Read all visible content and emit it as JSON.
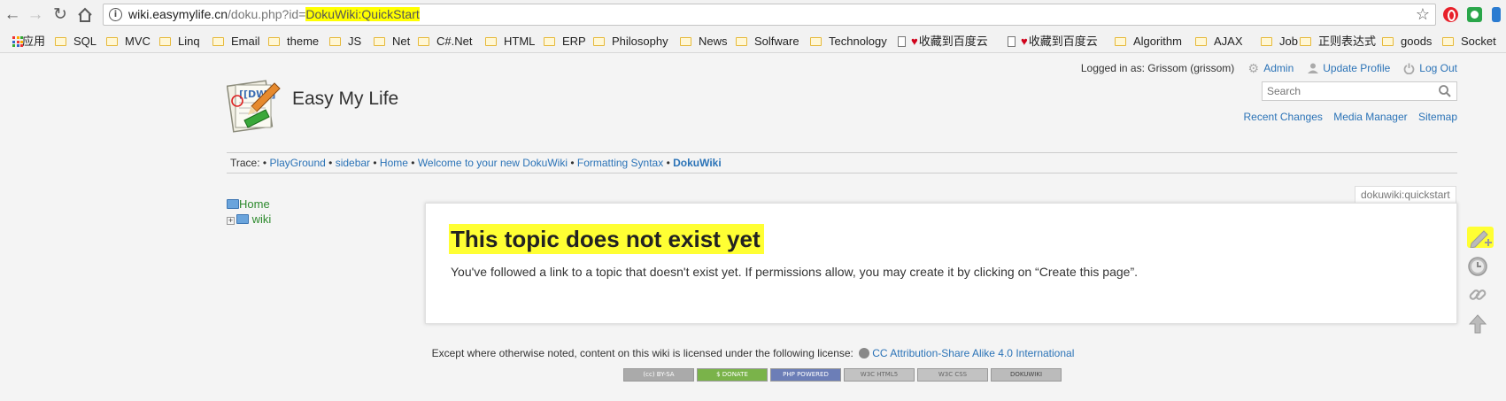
{
  "browser": {
    "url_host": "wiki.easymylife.cn",
    "url_path": "/doku.php?id=",
    "url_query_highlight": "DokuWiki:QuickStart",
    "bookmarks": [
      {
        "label": "应用",
        "type": "apps"
      },
      {
        "label": "SQL",
        "type": "folder"
      },
      {
        "label": "MVC",
        "type": "folder"
      },
      {
        "label": "Linq",
        "type": "folder"
      },
      {
        "label": "Email",
        "type": "folder"
      },
      {
        "label": "theme",
        "type": "folder"
      },
      {
        "label": "JS",
        "type": "folder"
      },
      {
        "label": "Net",
        "type": "folder"
      },
      {
        "label": "C#.Net",
        "type": "folder"
      },
      {
        "label": "HTML",
        "type": "folder"
      },
      {
        "label": "ERP",
        "type": "folder"
      },
      {
        "label": "Philosophy",
        "type": "folder"
      },
      {
        "label": "News",
        "type": "folder"
      },
      {
        "label": "Solfware",
        "type": "folder"
      },
      {
        "label": "Technology",
        "type": "folder"
      },
      {
        "label": "收藏到百度云",
        "type": "page-heart"
      },
      {
        "label": "收藏到百度云",
        "type": "page-heart"
      },
      {
        "label": "Algorithm",
        "type": "folder"
      },
      {
        "label": "AJAX",
        "type": "folder"
      },
      {
        "label": "Job",
        "type": "folder"
      },
      {
        "label": "正则表达式",
        "type": "folder"
      },
      {
        "label": "goods",
        "type": "folder"
      },
      {
        "label": "Socket",
        "type": "folder"
      }
    ]
  },
  "header": {
    "site_title": "Easy My Life",
    "logged_in_text": "Logged in as: Grissom (grissom)",
    "admin_link": "Admin",
    "profile_link": "Update Profile",
    "logout_link": "Log Out",
    "search_placeholder": "Search",
    "site_tools": [
      "Recent Changes",
      "Media Manager",
      "Sitemap"
    ]
  },
  "trace": {
    "label": "Trace:",
    "items": [
      "PlayGround",
      "sidebar",
      "Home",
      "Welcome to your new DokuWiki",
      "Formatting Syntax",
      "DokuWiki"
    ]
  },
  "sidebar": {
    "home": "Home",
    "wiki": "wiki"
  },
  "content": {
    "page_id": "dokuwiki:quickstart",
    "heading": "This topic does not exist yet",
    "message": "You've followed a link to a topic that doesn't exist yet. If permissions allow, you may create it by clicking on “Create this page”."
  },
  "footer": {
    "license_text": "Except where otherwise noted, content on this wiki is licensed under the following license:",
    "license_link": "CC Attribution-Share Alike 4.0 International",
    "badges": [
      "(cc) BY-SA",
      "$ DONATE",
      "PHP POWERED",
      "W3C HTML5",
      "W3C CSS",
      "DOKUWIKI"
    ]
  }
}
